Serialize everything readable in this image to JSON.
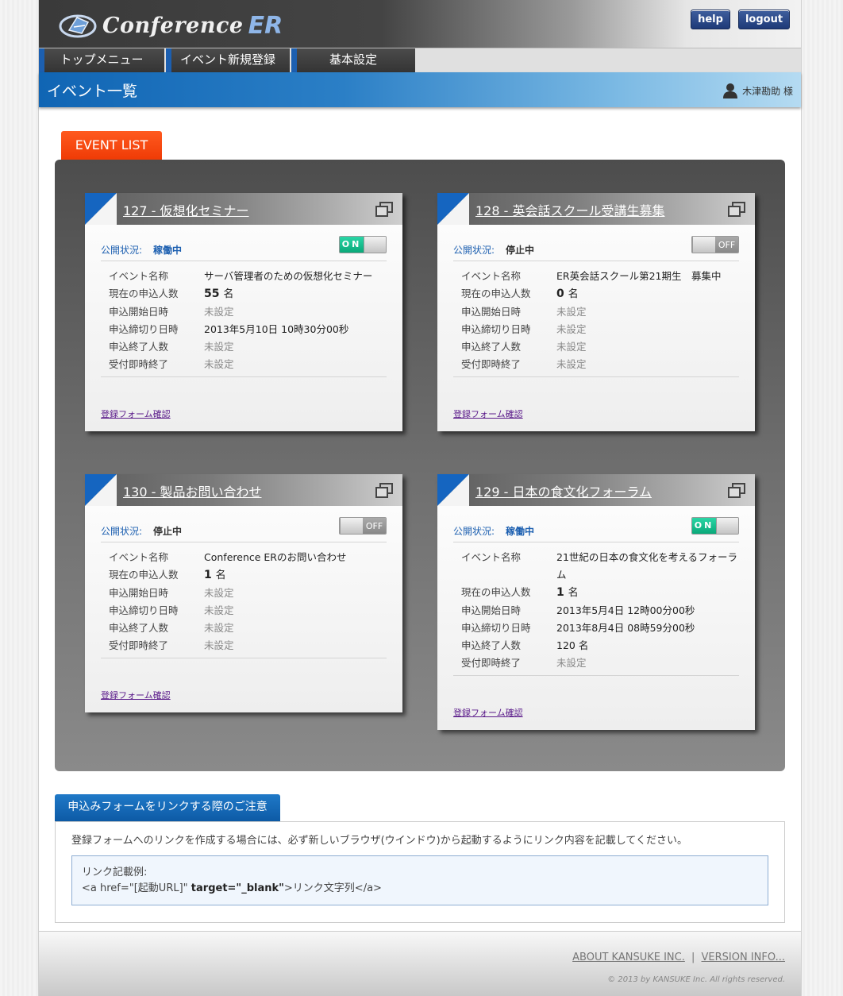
{
  "header": {
    "logo_text": "Conference",
    "logo_text2": "ER",
    "help_label": "help",
    "logout_label": "logout"
  },
  "nav": [
    {
      "label": "トップメニュー"
    },
    {
      "label": "イベント新規登録"
    },
    {
      "label": "基本設定"
    }
  ],
  "titlebar": {
    "title": "イベント一覧",
    "user": "木津勘助 様"
  },
  "event_list_tab": "EVENT LIST",
  "labels": {
    "status": "公開状況:",
    "name": "イベント名称",
    "count": "現在の申込人数",
    "start": "申込開始日時",
    "deadline": "申込締切り日時",
    "limit": "申込終了人数",
    "auto_close": "受付即時終了",
    "form_link": "登録フォーム確認",
    "toggle_on": "ON",
    "toggle_off": "OFF",
    "count_unit": "名"
  },
  "cards": [
    {
      "title": "127 - 仮想化セミナー",
      "status": "稼働中",
      "toggle": "on",
      "name": "サーバ管理者のための仮想化セミナー",
      "count": "55",
      "start": "未設定",
      "deadline": "2013年5月10日 10時30分00秒",
      "limit": "未設定",
      "auto_close": "未設定"
    },
    {
      "title": "128 - 英会話スクール受講生募集",
      "status": "停止中",
      "toggle": "off",
      "name": "ER英会話スクール第21期生　募集中",
      "count": "0",
      "start": "未設定",
      "deadline": "未設定",
      "limit": "未設定",
      "auto_close": "未設定"
    },
    {
      "title": "130 - 製品お問い合わせ",
      "status": "停止中",
      "toggle": "off",
      "name": "Conference ERのお問い合わせ",
      "count": "1",
      "start": "未設定",
      "deadline": "未設定",
      "limit": "未設定",
      "auto_close": "未設定"
    },
    {
      "title": "129 - 日本の食文化フォーラム",
      "status": "稼働中",
      "toggle": "on",
      "name": "21世紀の日本の食文化を考えるフォーラム",
      "count": "1",
      "start": "2013年5月4日 12時00分00秒",
      "deadline": "2013年8月4日 08時59分00秒",
      "limit": "120 名",
      "auto_close": "未設定"
    }
  ],
  "notice": {
    "tab": "申込みフォームをリンクする際のご注意",
    "text": "登録フォームへのリンクを作成する場合には、必ず新しいブラウザ(ウインドウ)から起動するようにリンク内容を記載してください。",
    "example_label": "リンク記載例:",
    "example_pre": "<a href=\"[起動URL]\" ",
    "example_bold": "target=\"_blank\"",
    "example_post": ">リンク文字列</a>"
  },
  "footer": {
    "about": "ABOUT KANSUKE INC.",
    "separator": "|",
    "version": "VERSION INFO...",
    "copyright": "© 2013 by KANSUKE Inc. All rights reserved."
  },
  "colors": {
    "accent_blue": "#1c5fb0",
    "tab_red": "#ef3a05",
    "toggle_on": "#0aa879"
  }
}
